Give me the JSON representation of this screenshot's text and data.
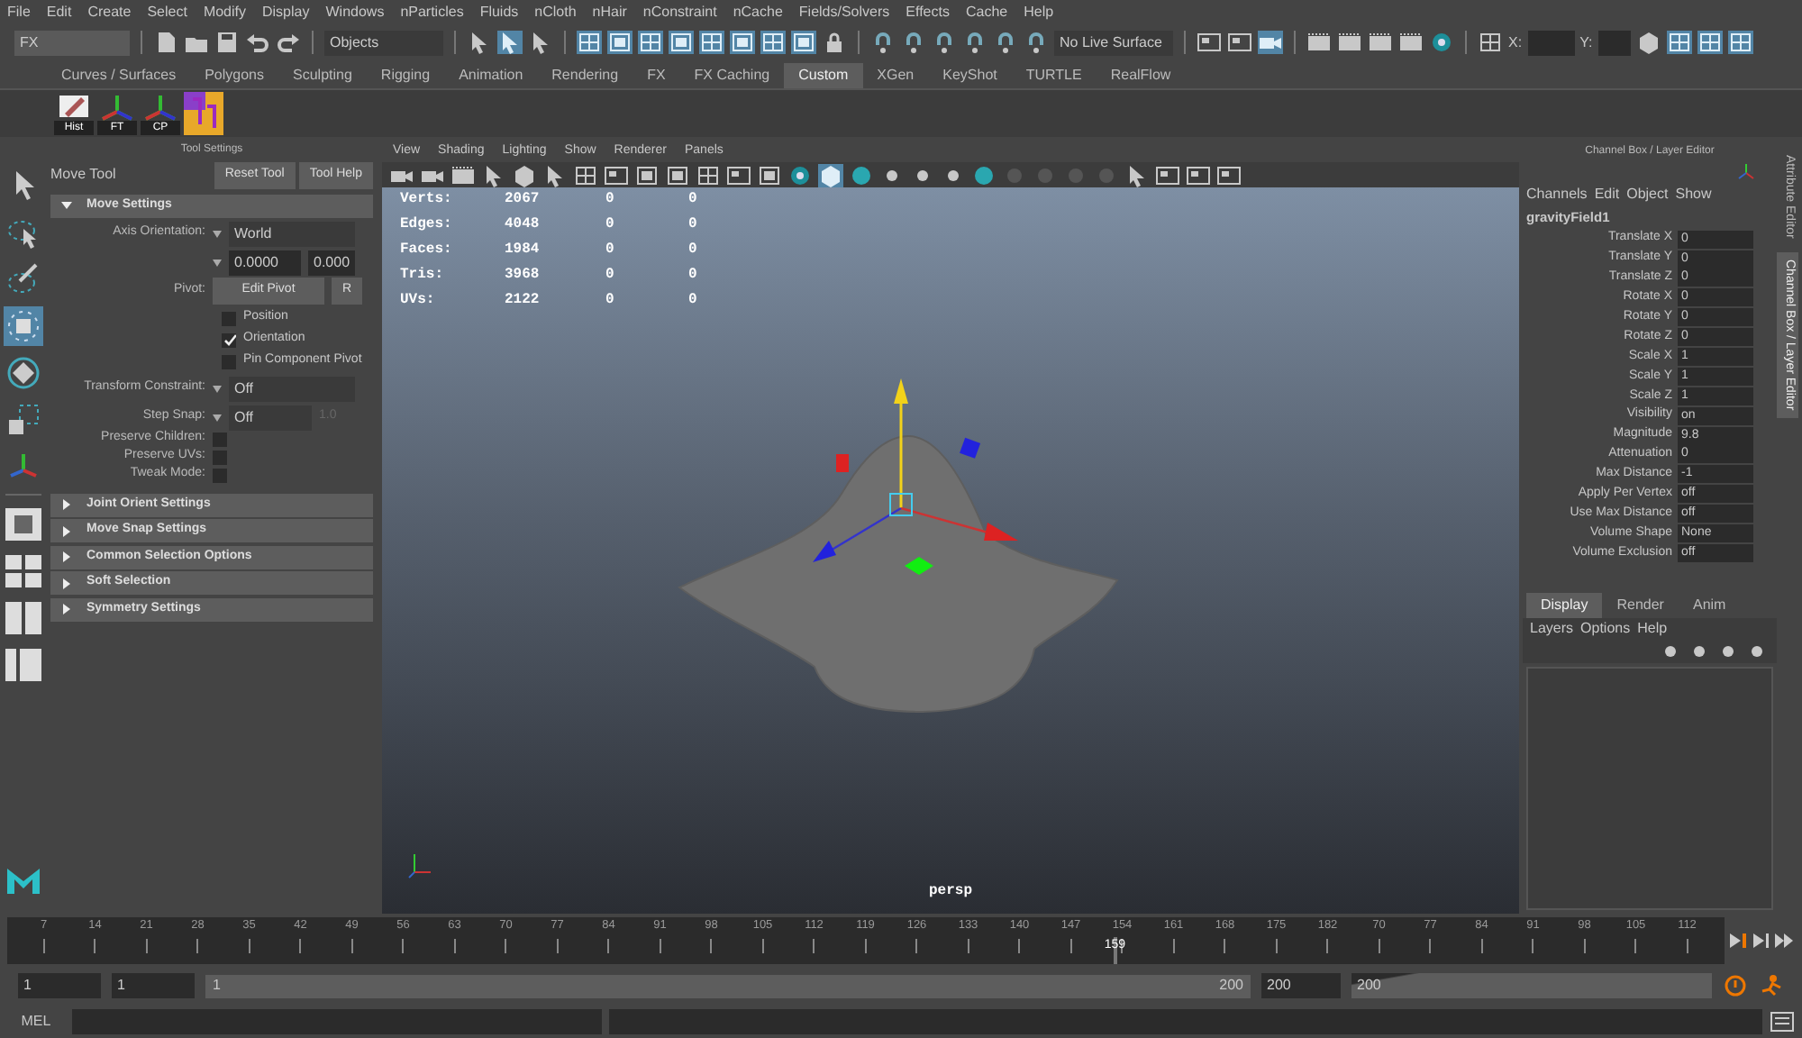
{
  "menu": [
    "File",
    "Edit",
    "Create",
    "Select",
    "Modify",
    "Display",
    "Windows",
    "nParticles",
    "Fluids",
    "nCloth",
    "nHair",
    "nConstraint",
    "nCache",
    "Fields/Solvers",
    "Effects",
    "Cache",
    "Help"
  ],
  "toolbar": {
    "mode": "FX",
    "selection_mode": "Objects",
    "live_surface": "No Live Surface",
    "x_label": "X:",
    "y_label": "Y:"
  },
  "shelf": {
    "tabs": [
      {
        "label": "Curves / Surfaces",
        "selected": false
      },
      {
        "label": "Polygons",
        "selected": false
      },
      {
        "label": "Sculpting",
        "selected": false
      },
      {
        "label": "Rigging",
        "selected": false
      },
      {
        "label": "Animation",
        "selected": false
      },
      {
        "label": "Rendering",
        "selected": false
      },
      {
        "label": "FX",
        "selected": false
      },
      {
        "label": "FX Caching",
        "selected": false
      },
      {
        "label": "Custom",
        "selected": true
      },
      {
        "label": "XGen",
        "selected": false
      },
      {
        "label": "KeyShot",
        "selected": false
      },
      {
        "label": "TURTLE",
        "selected": false
      },
      {
        "label": "RealFlow",
        "selected": false
      }
    ],
    "items": [
      {
        "kind": "pencil",
        "label": "Hist"
      },
      {
        "kind": "axes",
        "label": "FT"
      },
      {
        "kind": "axes",
        "label": "CP"
      },
      {
        "kind": "plugin"
      }
    ]
  },
  "tool_settings": {
    "title": "Tool Settings",
    "tool_name": "Move Tool",
    "buttons": [
      "Reset Tool",
      "Tool Help"
    ],
    "main_section": {
      "label": "Move Settings",
      "expanded": true
    },
    "axis_orientation": {
      "label": "Axis Orientation:",
      "value": "World"
    },
    "orientation_values": [
      "0.0000",
      "0.000"
    ],
    "pivot": {
      "label": "Pivot:",
      "button": "Edit Pivot",
      "button_2": "R"
    },
    "pivot_options": [
      {
        "label": "Position",
        "checked": false
      },
      {
        "label": "Orientation",
        "checked": true
      },
      {
        "label": "Pin Component Pivot",
        "checked": false
      }
    ],
    "transform_constraint": {
      "label": "Transform Constraint:",
      "value": "Off"
    },
    "step_snap": {
      "label": "Step Snap:",
      "value": "Off",
      "amount": "1.0"
    },
    "options": [
      {
        "label": "Preserve Children:",
        "checked": false
      },
      {
        "label": "Preserve UVs:",
        "checked": false
      },
      {
        "label": "Tweak Mode:",
        "checked": false
      }
    ],
    "sections": [
      {
        "label": "Joint Orient Settings",
        "expanded": false
      },
      {
        "label": "Move Snap Settings",
        "expanded": false
      },
      {
        "label": "Common Selection Options",
        "expanded": false
      },
      {
        "label": "Soft Selection",
        "expanded": false
      },
      {
        "label": "Symmetry Settings",
        "expanded": false
      }
    ]
  },
  "viewport": {
    "menu": [
      "View",
      "Shading",
      "Lighting",
      "Show",
      "Renderer",
      "Panels"
    ],
    "hud": [
      {
        "label": "Verts:",
        "values": [
          "2067",
          "0",
          "0"
        ]
      },
      {
        "label": "Edges:",
        "values": [
          "4048",
          "0",
          "0"
        ]
      },
      {
        "label": "Faces:",
        "values": [
          "1984",
          "0",
          "0"
        ]
      },
      {
        "label": "Tris:",
        "values": [
          "3968",
          "0",
          "0"
        ]
      },
      {
        "label": "UVs:",
        "values": [
          "2122",
          "0",
          "0"
        ]
      }
    ],
    "camera": "persp"
  },
  "channel_box": {
    "title": "Channel Box / Layer Editor",
    "menu": [
      "Channels",
      "Edit",
      "Object",
      "Show"
    ],
    "node": "gravityField1",
    "attributes": [
      {
        "name": "Translate X",
        "value": "0"
      },
      {
        "name": "Translate Y",
        "value": "0"
      },
      {
        "name": "Translate Z",
        "value": "0"
      },
      {
        "name": "Rotate X",
        "value": "0"
      },
      {
        "name": "Rotate Y",
        "value": "0"
      },
      {
        "name": "Rotate Z",
        "value": "0"
      },
      {
        "name": "Scale X",
        "value": "1"
      },
      {
        "name": "Scale Y",
        "value": "1"
      },
      {
        "name": "Scale Z",
        "value": "1"
      },
      {
        "name": "Visibility",
        "value": "on"
      },
      {
        "name": "Magnitude",
        "value": "9.8"
      },
      {
        "name": "Attenuation",
        "value": "0"
      },
      {
        "name": "Max Distance",
        "value": "-1"
      },
      {
        "name": "Apply Per Vertex",
        "value": "off"
      },
      {
        "name": "Use Max Distance",
        "value": "off"
      },
      {
        "name": "Volume Shape",
        "value": "None"
      },
      {
        "name": "Volume Exclusion",
        "value": "off"
      }
    ],
    "layer_tabs": [
      {
        "label": "Display",
        "selected": true
      },
      {
        "label": "Render",
        "selected": false
      },
      {
        "label": "Anim",
        "selected": false
      }
    ],
    "layer_menu": [
      "Layers",
      "Options",
      "Help"
    ]
  },
  "side_tabs": [
    {
      "label": "Attribute Editor",
      "selected": false
    },
    {
      "label": "Channel Box / Layer Editor",
      "selected": true
    }
  ],
  "timeline": {
    "ticks": [
      "7",
      "14",
      "21",
      "28",
      "35",
      "42",
      "49",
      "56",
      "63",
      "70",
      "77",
      "84",
      "91",
      "98",
      "105",
      "112",
      "119",
      "126",
      "133",
      "140",
      "147",
      "154",
      "161",
      "168",
      "175",
      "182",
      "70",
      "77",
      "84",
      "91",
      "98",
      "105",
      "112"
    ],
    "playhead": {
      "label": "159",
      "level": 0.645
    }
  },
  "range": {
    "level": 1,
    "start": "1",
    "playback_start": "1",
    "range_start": "1",
    "range_end": "200",
    "playback_end": "200",
    "end": "200"
  },
  "command_line": {
    "language": "MEL"
  }
}
